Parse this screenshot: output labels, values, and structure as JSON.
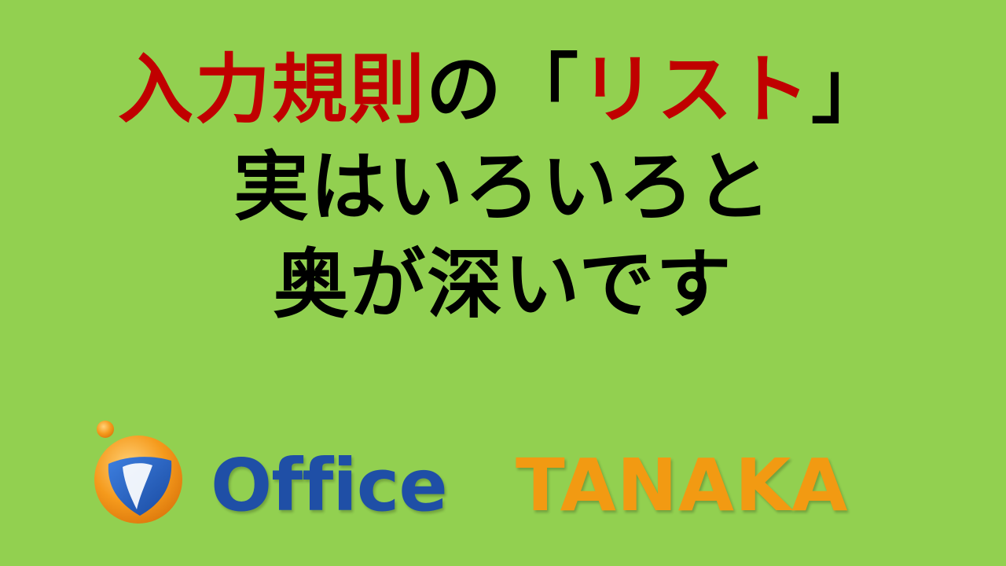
{
  "title": {
    "line1_red_a": "入力規則",
    "line1_black_a": "の「",
    "line1_red_b": "リスト",
    "line1_black_b": "」",
    "line2": "実はいろいろと",
    "line3": "奥が深いです"
  },
  "logo": {
    "word1": "Office",
    "word2": "TANAKA",
    "mark_icon": "office-tanaka-logo-mark-icon"
  },
  "colors": {
    "background": "#92d050",
    "accent_red": "#c00000",
    "text_black": "#000000",
    "logo_blue": "#1f4fa6",
    "logo_orange": "#f29a12"
  }
}
